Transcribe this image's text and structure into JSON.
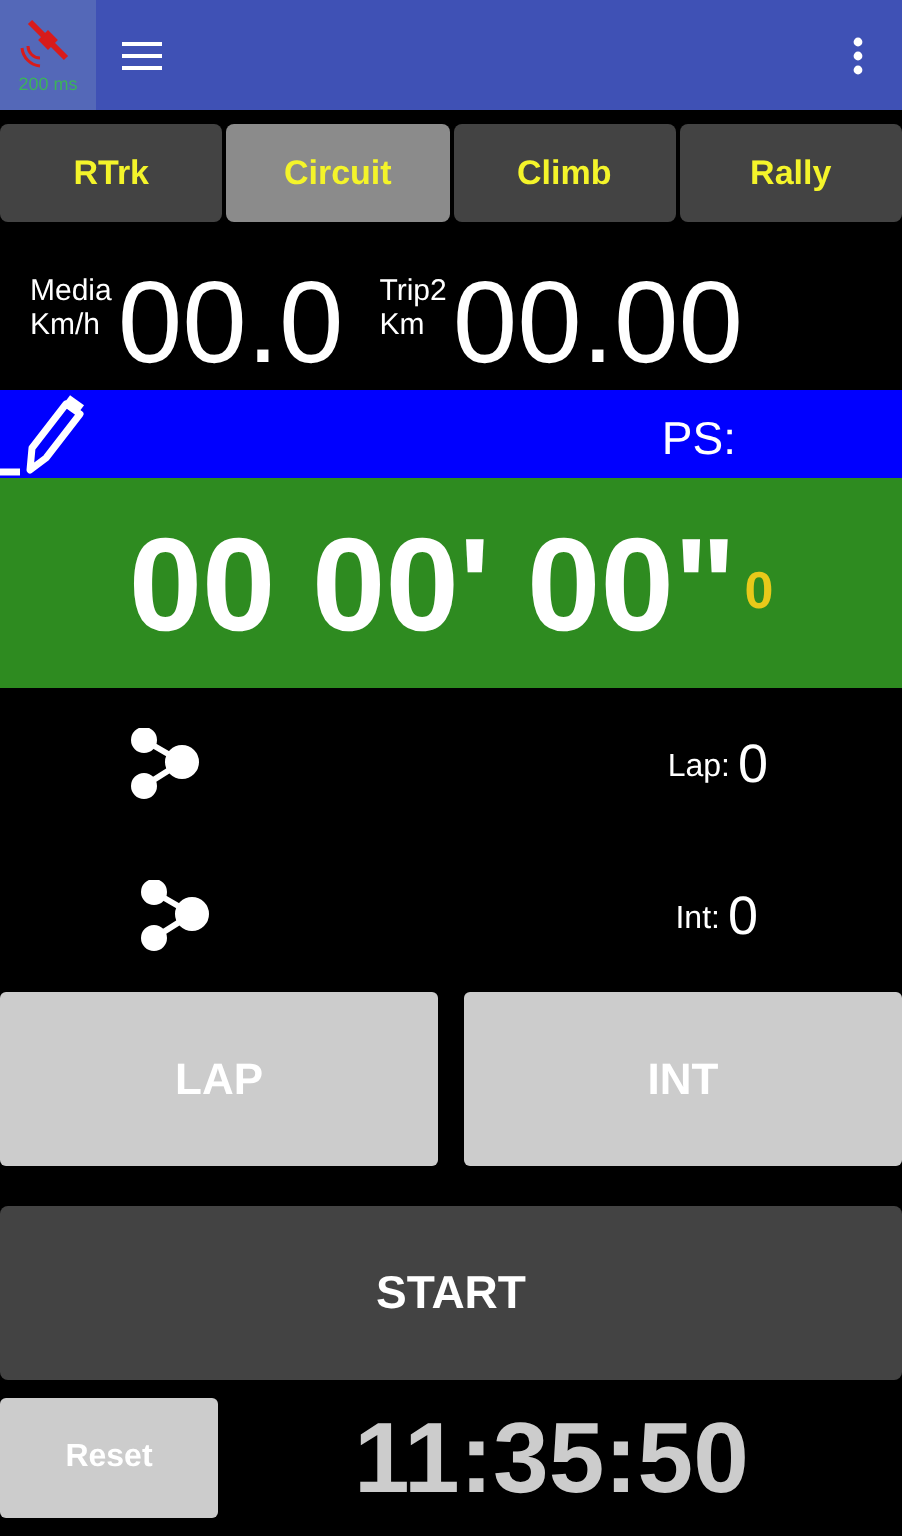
{
  "gps": {
    "status": "200 ms"
  },
  "tabs": [
    {
      "label": "RTrk",
      "selected": false
    },
    {
      "label": "Circuit",
      "selected": true
    },
    {
      "label": "Climb",
      "selected": false
    },
    {
      "label": "Rally",
      "selected": false
    }
  ],
  "speed": {
    "label_top": "Media",
    "label_bottom": "Km/h",
    "value": "00.0"
  },
  "trip": {
    "label_top": "Trip2",
    "label_bottom": "Km",
    "value": "00.00"
  },
  "ps_label": "PS:",
  "timer": {
    "value": "00 00' 00\"",
    "tenths": "0"
  },
  "counters": [
    {
      "label": "Lap:",
      "value": "0"
    },
    {
      "label": "Int:",
      "value": "0"
    }
  ],
  "buttons": [
    "LAP",
    "INT"
  ],
  "start": "START",
  "reset": "Reset",
  "clock": "11:35:50"
}
